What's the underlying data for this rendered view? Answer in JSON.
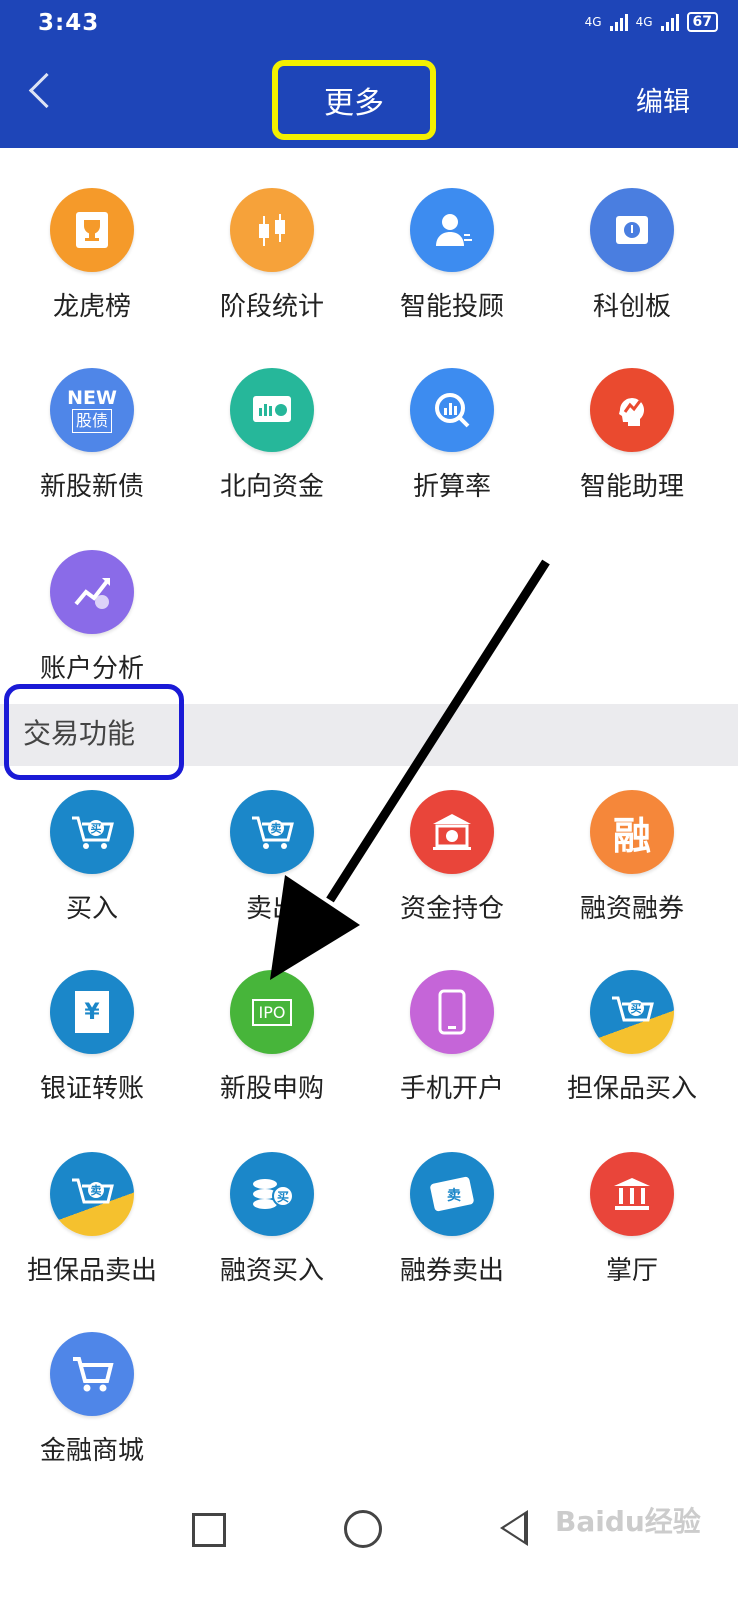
{
  "status_bar": {
    "time": "3:43",
    "network1": "4G",
    "network2": "4G",
    "battery": "67"
  },
  "header": {
    "title": "更多",
    "edit_label": "编辑"
  },
  "row1": [
    {
      "label": "龙虎榜",
      "icon": "trophy-icon",
      "color": "#f59a2a"
    },
    {
      "label": "阶段统计",
      "icon": "candlestick-icon",
      "color": "#f6a23a"
    },
    {
      "label": "智能投顾",
      "icon": "advisor-icon",
      "color": "#3d8cf0"
    },
    {
      "label": "科创板",
      "icon": "chip-icon",
      "color": "#4a7ee0"
    }
  ],
  "row2": [
    {
      "label": "新股新债",
      "icon": "new-stock-icon",
      "color": "#4f86e8",
      "badge_top": "NEW",
      "badge_bottom": "股债"
    },
    {
      "label": "北向资金",
      "icon": "northbound-icon",
      "color": "#26b79a"
    },
    {
      "label": "折算率",
      "icon": "magnifier-chart-icon",
      "color": "#3d8cf0"
    },
    {
      "label": "智能助理",
      "icon": "assistant-head-icon",
      "color": "#ea4a2f"
    }
  ],
  "row3": [
    {
      "label": "账户分析",
      "icon": "account-analysis-icon",
      "color": "#8a6be8"
    }
  ],
  "section_label": "交易功能",
  "trade_row1": [
    {
      "label": "买入",
      "icon": "cart-buy-icon",
      "color": "#1b87c9",
      "glyph": "买"
    },
    {
      "label": "卖出",
      "icon": "cart-sell-icon",
      "color": "#1b87c9",
      "glyph": "卖"
    },
    {
      "label": "资金持仓",
      "icon": "bank-icon",
      "color": "#e9453a"
    },
    {
      "label": "融资融券",
      "icon": "margin-icon",
      "color": "#f5873a",
      "glyph": "融"
    }
  ],
  "trade_row2": [
    {
      "label": "银证转账",
      "icon": "transfer-icon",
      "color": "#1b87c9",
      "glyph": "¥"
    },
    {
      "label": "新股申购",
      "icon": "ipo-icon",
      "color": "#47b53a",
      "glyph": "IPO"
    },
    {
      "label": "手机开户",
      "icon": "phone-icon",
      "color": "#c565d8"
    },
    {
      "label": "担保品买入",
      "icon": "collateral-buy-icon",
      "color": "#1b87c9",
      "glyph": "买"
    }
  ],
  "trade_row3": [
    {
      "label": "担保品卖出",
      "icon": "collateral-sell-icon",
      "color": "#1b87c9",
      "glyph": "卖"
    },
    {
      "label": "融资买入",
      "icon": "coins-buy-icon",
      "color": "#1b87c9",
      "glyph": "买"
    },
    {
      "label": "融券卖出",
      "icon": "ticket-sell-icon",
      "color": "#1b87c9",
      "glyph": "卖"
    },
    {
      "label": "掌厅",
      "icon": "hall-icon",
      "color": "#e9453a"
    }
  ],
  "trade_row4": [
    {
      "label": "金融商城",
      "icon": "shopping-cart-icon",
      "color": "#4f86e8"
    }
  ],
  "watermark": "Baidu经验"
}
